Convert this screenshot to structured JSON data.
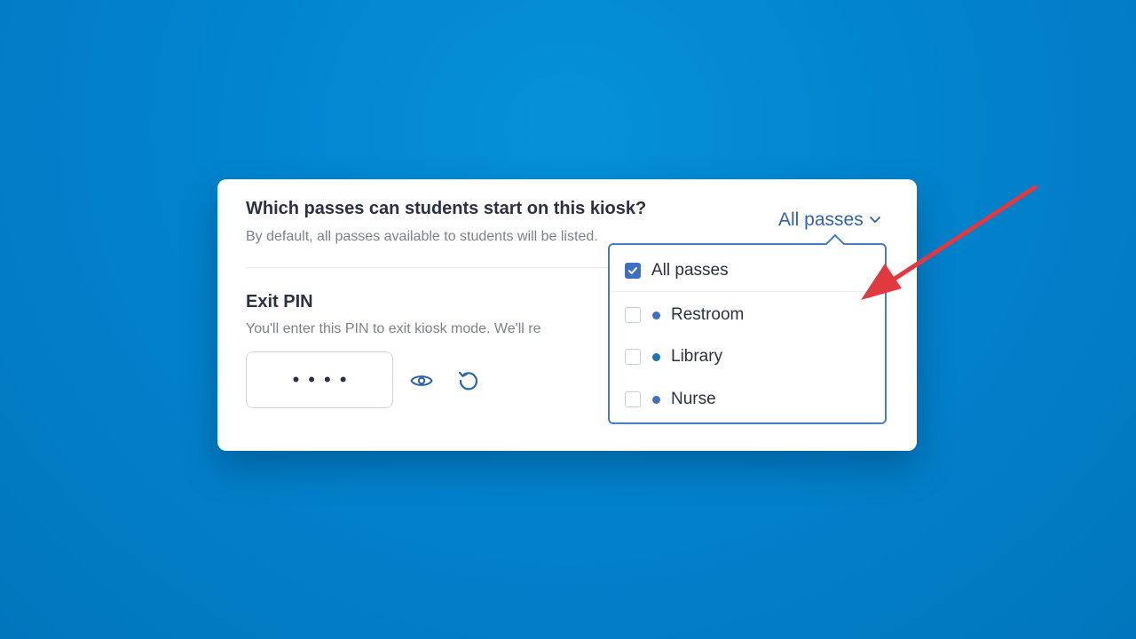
{
  "passes_section": {
    "title": "Which passes can students start on this kiosk?",
    "description": "By default, all passes available to students will be listed."
  },
  "pin_section": {
    "title": "Exit PIN",
    "description": "You'll enter this PIN to exit kiosk mode. We'll re",
    "masked_value": "••••",
    "icons": [
      "eye-icon",
      "reset-icon"
    ]
  },
  "dropdown": {
    "selected_label": "All passes",
    "icon": "chevron-down-icon",
    "options": [
      {
        "label": "All passes",
        "checked": true
      },
      {
        "label": "Restroom",
        "checked": false,
        "dot_color": "#3f6fc0"
      },
      {
        "label": "Library",
        "checked": false,
        "dot_color": "#1a74b8"
      },
      {
        "label": "Nurse",
        "checked": false,
        "dot_color": "#3f6fc0"
      }
    ]
  },
  "colors": {
    "background": "#0283cd",
    "accent": "#3f6fc0",
    "annotation_arrow": "#e0393f"
  }
}
